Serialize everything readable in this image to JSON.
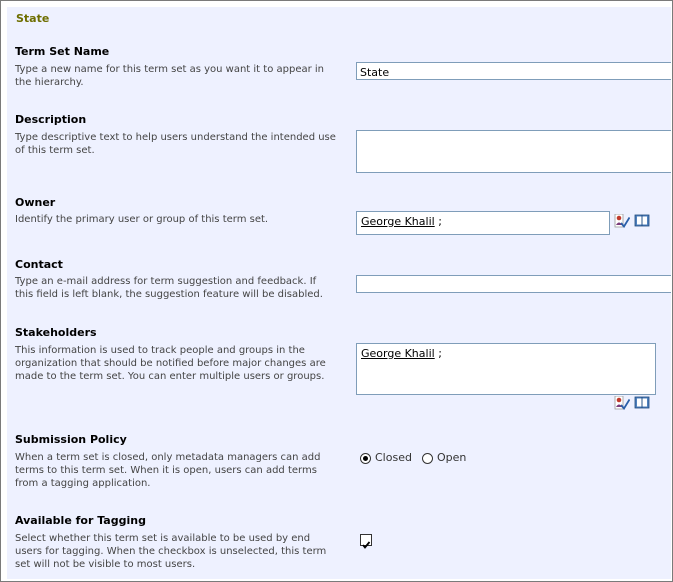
{
  "title": "State",
  "term_set_name": {
    "heading": "Term Set Name",
    "description": "Type a new name for this term set as you want it to appear in the hierarchy.",
    "value": "State"
  },
  "description_field": {
    "heading": "Description",
    "description": "Type descriptive text to help users understand the intended use of this term set.",
    "value": ""
  },
  "owner": {
    "heading": "Owner",
    "description": "Identify the primary user or group of this term set.",
    "user": "George Khalil",
    "sep": ";"
  },
  "contact": {
    "heading": "Contact",
    "description": "Type an e-mail address for term suggestion and feedback. If this field is left blank, the suggestion feature will be disabled.",
    "value": ""
  },
  "stakeholders": {
    "heading": "Stakeholders",
    "description": "This information is used to track people and groups in the organization that should be notified before major changes are made to the term set. You can enter multiple users or groups.",
    "user": "George Khalil",
    "sep": ";"
  },
  "submission_policy": {
    "heading": "Submission Policy",
    "description": "When a term set is closed, only metadata managers can add terms to this term set. When it is open, users can add terms from a tagging application.",
    "options": [
      "Closed",
      "Open"
    ],
    "selected": "Closed"
  },
  "available_for_tagging": {
    "heading": "Available for Tagging",
    "description": "Select whether this term set is available to be used by end users for tagging. When the checkbox is unselected, this term set will not be visible to most users.",
    "checked": true
  },
  "icons": {
    "check_names": "check-names-icon",
    "browse": "address-book-icon"
  }
}
